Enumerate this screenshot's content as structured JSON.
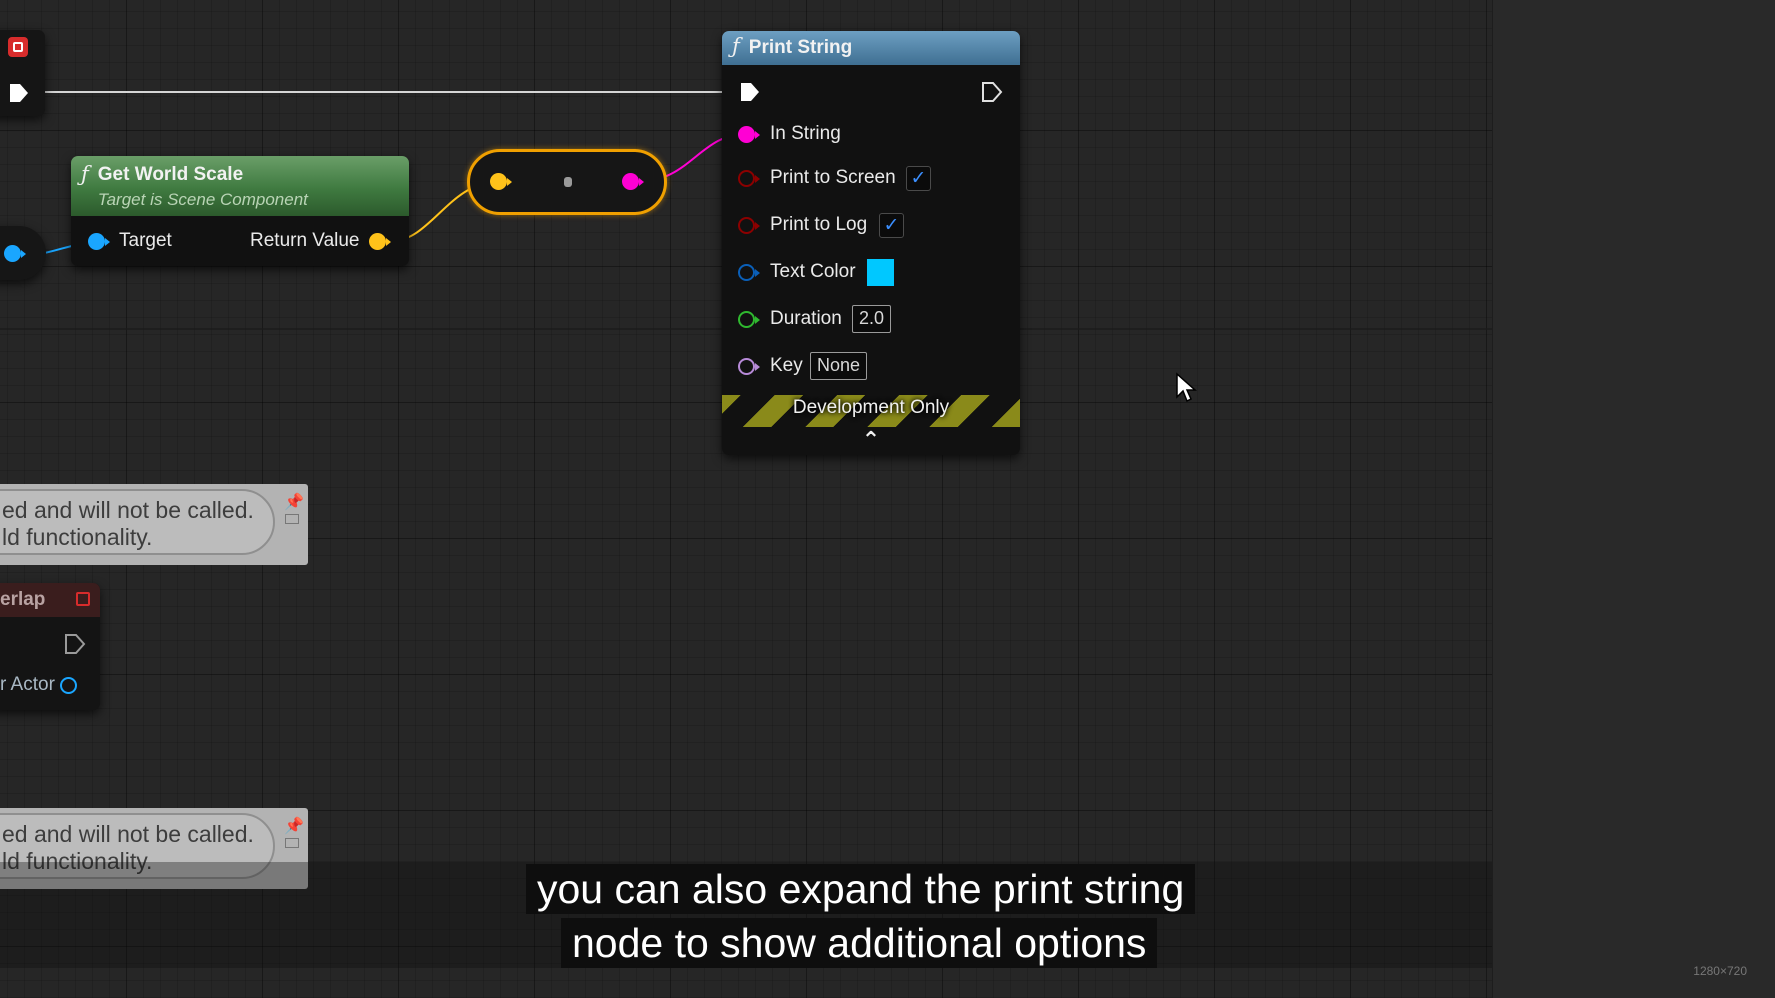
{
  "print_string": {
    "title": "Print String",
    "rows": {
      "in_string": "In String",
      "print_to_screen": "Print to Screen",
      "print_to_log": "Print to Log",
      "text_color": "Text Color",
      "duration": "Duration",
      "duration_value": "2.0",
      "key": "Key",
      "key_value": "None"
    },
    "dev_banner": "Development Only",
    "text_color_swatch": "#00c8ff",
    "checkmark": "✓",
    "collapse_glyph": "⌃"
  },
  "get_world_scale": {
    "title": "Get World Scale",
    "subtitle": "Target is Scene Component",
    "target_label": "Target",
    "return_label": "Return Value"
  },
  "comments": [
    {
      "line1": "ed and will not be called.",
      "line2": "ld functionality."
    },
    {
      "line1": "ed and will not be called.",
      "line2": "ld functionality."
    }
  ],
  "overlap_node": {
    "title": "erlap",
    "pin_label": "r Actor"
  },
  "subtitle": {
    "line1": "you can also expand the print string",
    "line2": "node to show additional options"
  },
  "resolution_label": "1280×720",
  "colors": {
    "exec": "#ffffff",
    "string_pin": "#ff00d4",
    "bool_pin": "#8c0000",
    "struct_pin": "#0a5fb8",
    "float_pin": "#2fb82f",
    "name_pin": "#b78ad8",
    "vector_pin": "#ffc21a",
    "object_pin": "#1aa6ff",
    "pure_header": "#4f8a4f",
    "callable_header": "#4c7da4"
  }
}
